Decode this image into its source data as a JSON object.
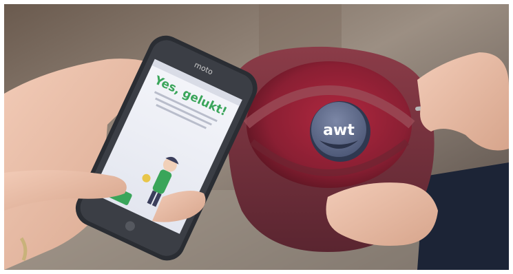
{
  "photo": {
    "phone_brand": "moto",
    "screen_title": "Yes, gelukt!",
    "tag_logo": "awt"
  },
  "colors": {
    "pouch": "#7a2f3a",
    "pouch_inner": "#a0243a",
    "screen_bg": "#eef0f6",
    "title_green": "#3aa55a",
    "tag_body": "#5a6685",
    "tag_rim": "#3e4a66"
  }
}
